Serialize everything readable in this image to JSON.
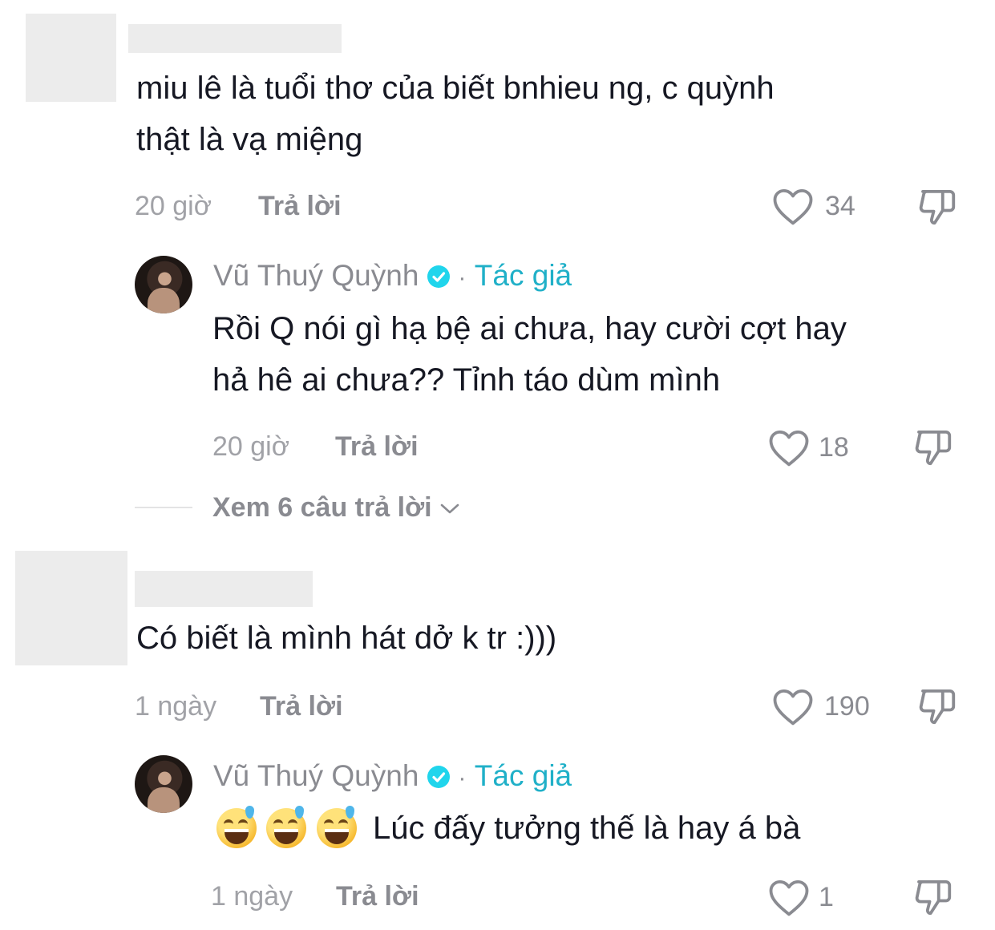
{
  "comments": [
    {
      "text_line1": "miu lê là tuổi thơ của biết bnhieu ng, c quỳnh",
      "text_line2": "thật là vạ miệng",
      "time": "20 giờ",
      "reply_label": "Trả lời",
      "likes": "34",
      "reply": {
        "author_name": "Vũ Thuý Quỳnh",
        "separator": "·",
        "author_badge": "Tác giả",
        "text_line1": "Rồi Q nói gì hạ bệ ai chưa, hay cười cợt hay",
        "text_line2": "hả hê ai chưa?? Tỉnh táo dùm mình",
        "time": "20 giờ",
        "reply_label": "Trả lời",
        "likes": "18"
      },
      "view_replies": "Xem 6 câu trả lời"
    },
    {
      "text_line1": "Có biết là mình hát dở k tr :)))",
      "time": "1 ngày",
      "reply_label": "Trả lời",
      "likes": "190",
      "reply": {
        "author_name": "Vũ Thuý Quỳnh",
        "separator": "·",
        "author_badge": "Tác giả",
        "emoji": [
          "grinning-sweat-emoji",
          "grinning-sweat-emoji",
          "grinning-sweat-emoji"
        ],
        "text_line1": "Lúc đấy tưởng thế là hay á bà",
        "time": "1 ngày",
        "reply_label": "Trả lời",
        "likes": "1"
      }
    }
  ],
  "icons": {
    "like": "heart-outline-icon",
    "dislike": "thumbs-down-outline-icon",
    "verified": "verified-check-icon",
    "expand": "chevron-down-icon"
  },
  "colors": {
    "author_badge": "#20b0c8",
    "verified": "#20d5ec",
    "muted": "#8a8b91"
  }
}
